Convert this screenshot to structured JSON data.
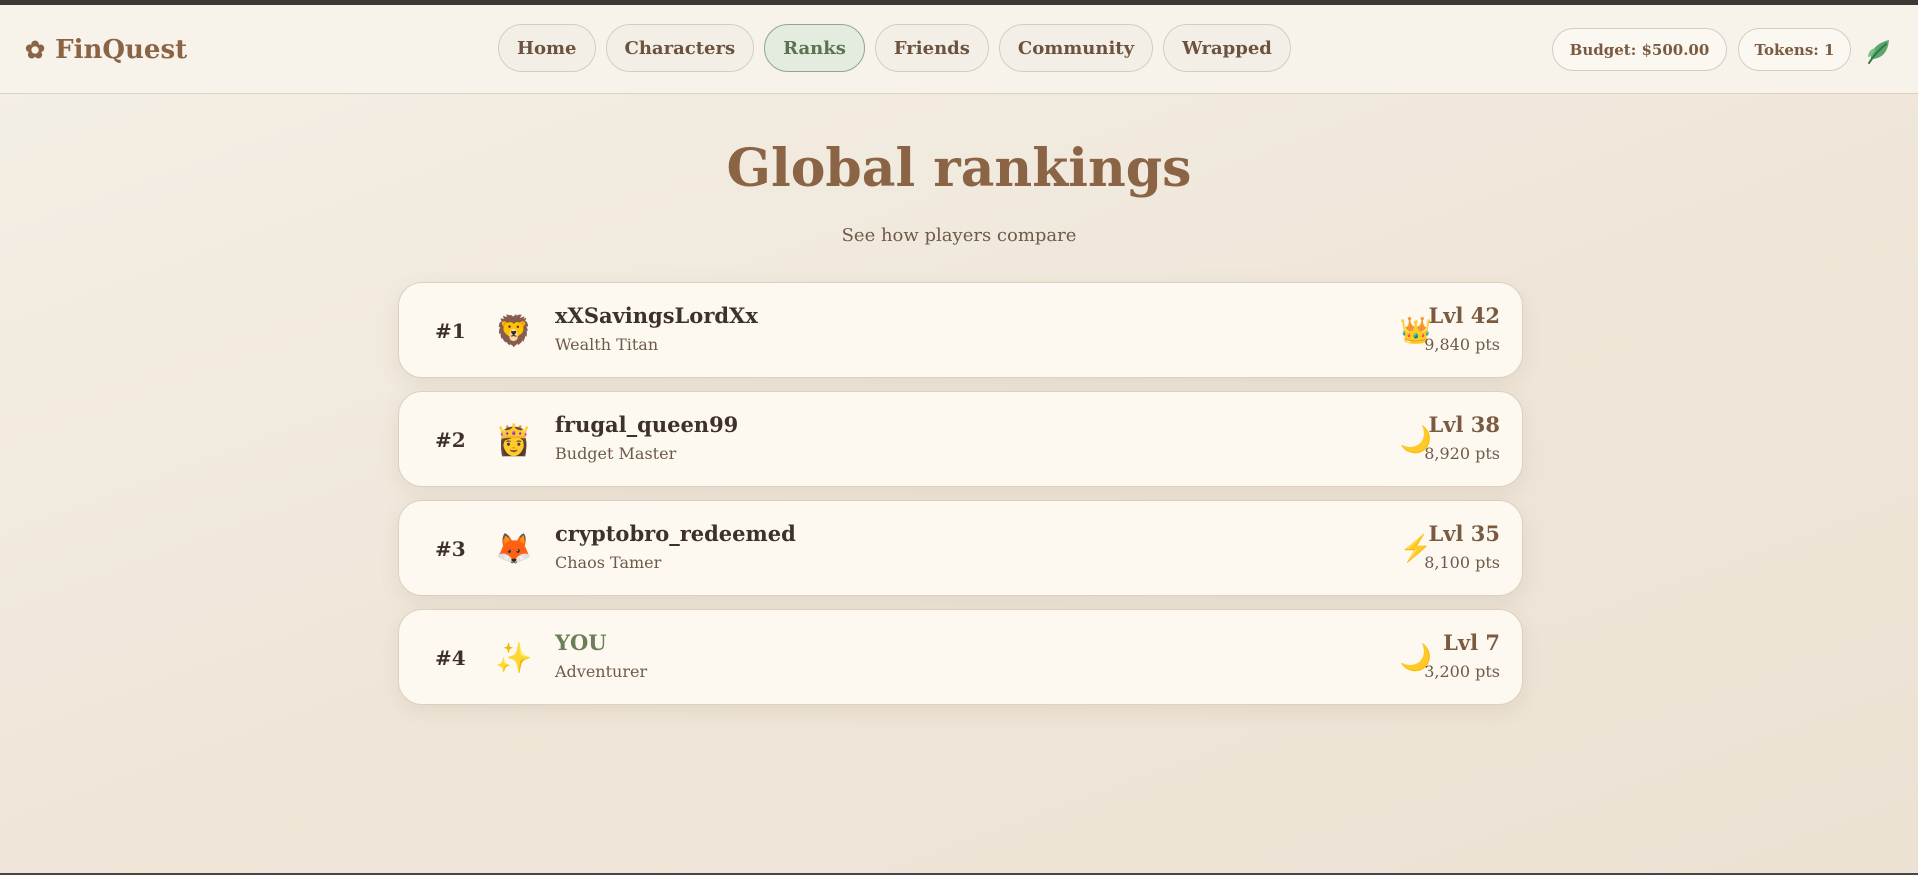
{
  "app": {
    "name": "FinQuest",
    "logo_icon": "flower-icon"
  },
  "nav": {
    "items": [
      {
        "label": "Home",
        "active": false
      },
      {
        "label": "Characters",
        "active": false
      },
      {
        "label": "Ranks",
        "active": true
      },
      {
        "label": "Friends",
        "active": false
      },
      {
        "label": "Community",
        "active": false
      },
      {
        "label": "Wrapped",
        "active": false
      }
    ]
  },
  "status": {
    "budget": "Budget: $500.00",
    "tokens": "Tokens: 1",
    "profile_icon": "leaf-icon"
  },
  "page": {
    "title": "Global rankings",
    "subtitle": "See how players compare"
  },
  "rankings": [
    {
      "rank": "#1",
      "avatar": "🦁",
      "avatar_icon": "lion-avatar-icon",
      "name": "xXSavingsLordXx",
      "title": "Wealth Titan",
      "badge": "👑",
      "badge_icon": "crown-icon",
      "level": "Lvl 42",
      "points": "9,840 pts"
    },
    {
      "rank": "#2",
      "avatar": "👸",
      "avatar_icon": "princess-avatar-icon",
      "name": "frugal_queen99",
      "title": "Budget Master",
      "badge": "🌙",
      "badge_icon": "moon-icon",
      "level": "Lvl 38",
      "points": "8,920 pts"
    },
    {
      "rank": "#3",
      "avatar": "🦊",
      "avatar_icon": "fox-avatar-icon",
      "name": "cryptobro_redeemed",
      "title": "Chaos Tamer",
      "badge": "⚡",
      "badge_icon": "lightning-icon",
      "level": "Lvl 35",
      "points": "8,100 pts"
    },
    {
      "rank": "#4",
      "avatar": "✨",
      "avatar_icon": "sparkles-avatar-icon",
      "name": "YOU",
      "title": "Adventurer",
      "badge": "🌙",
      "badge_icon": "moon-icon",
      "level": "Lvl 7",
      "points": "3,200 pts"
    }
  ],
  "colors": {
    "brand": "#8b6446",
    "accent_green": "#5a7350",
    "active_pill_bg": "#e3ecdf",
    "card_bg": "#fdf9f1"
  }
}
